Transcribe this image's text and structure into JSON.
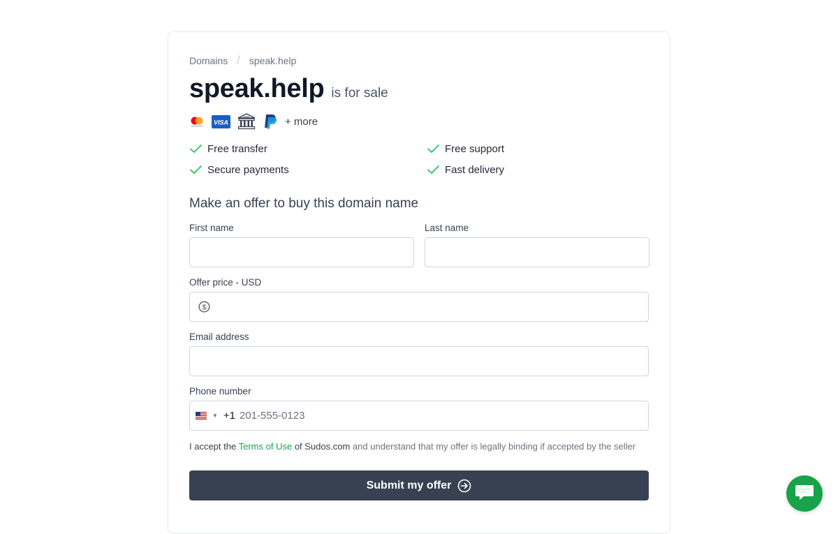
{
  "breadcrumb": {
    "root": "Domains",
    "separator": "/",
    "current": "speak.help"
  },
  "header": {
    "domain": "speak.help",
    "suffix": "is for sale"
  },
  "payments": {
    "icons": [
      "mastercard-icon",
      "visa-icon",
      "bank-icon",
      "paypal-icon"
    ],
    "visa_text": "VISA",
    "bank_text": "BANK",
    "more_label": "+ more"
  },
  "features": [
    {
      "label": "Free transfer"
    },
    {
      "label": "Free support"
    },
    {
      "label": "Secure payments"
    },
    {
      "label": "Fast delivery"
    }
  ],
  "form": {
    "heading": "Make an offer to buy this domain name",
    "first_name": {
      "label": "First name",
      "value": ""
    },
    "last_name": {
      "label": "Last name",
      "value": ""
    },
    "offer_price": {
      "label": "Offer price - USD",
      "value": ""
    },
    "email": {
      "label": "Email address",
      "value": ""
    },
    "phone": {
      "label": "Phone number",
      "country": "US",
      "dial_code": "+1",
      "placeholder": "201-555-0123"
    },
    "terms": {
      "prefix": "I accept the",
      "link": "Terms of Use",
      "middle": "of Sudos.com",
      "suffix": "and understand that my offer is legally binding if accepted by the seller"
    },
    "submit_label": "Submit my offer"
  },
  "colors": {
    "accent": "#16a34a",
    "button": "#374151",
    "check": "#22c55e"
  }
}
